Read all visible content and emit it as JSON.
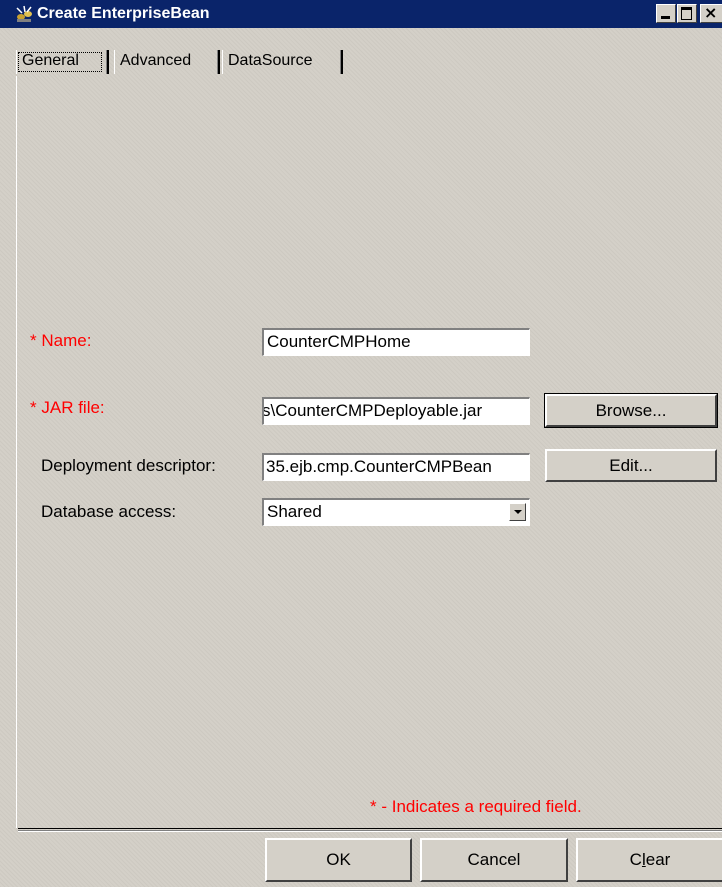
{
  "window": {
    "title": "Create EnterpriseBean"
  },
  "tabs": [
    {
      "label": "General",
      "active": true
    },
    {
      "label": "Advanced",
      "active": false
    },
    {
      "label": "DataSource",
      "active": false
    }
  ],
  "form": {
    "name": {
      "required_marker": "*",
      "label": "Name:",
      "value": "CounterCMPHome"
    },
    "jar_file": {
      "required_marker": "*",
      "label": "JAR file:",
      "value": "s\\CounterCMPDeployable.jar",
      "button_label": "Browse..."
    },
    "deployment_descriptor": {
      "label": "Deployment descriptor:",
      "value": "35.ejb.cmp.CounterCMPBean",
      "button_label": "Edit..."
    },
    "database_access": {
      "label": "Database access:",
      "selected": "Shared"
    }
  },
  "required_note": "* - Indicates a required field.",
  "buttons": {
    "ok": "OK",
    "cancel": "Cancel",
    "clear_prefix": "C",
    "clear_underlined": "l",
    "clear_suffix": "ear"
  },
  "colors": {
    "titlebar": "#0a246a",
    "required": "#ff0000",
    "face": "#d4d0c8"
  },
  "icons": {
    "app": "beans-app-icon",
    "minimize": "minimize-icon",
    "maximize": "maximize-icon",
    "close": "close-icon",
    "dropdown": "chevron-down-icon"
  }
}
